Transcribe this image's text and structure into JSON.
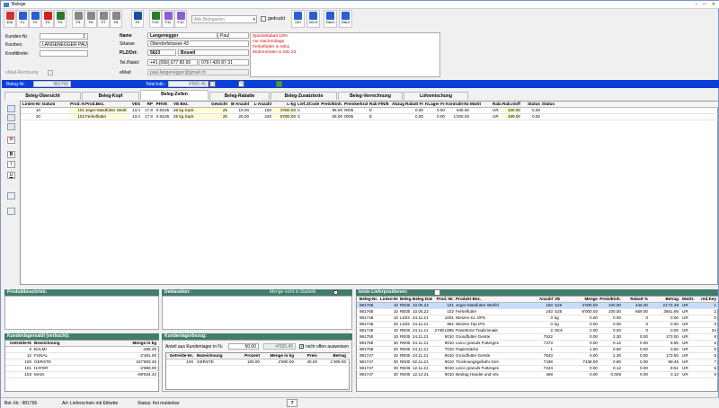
{
  "window": {
    "title": "Belege"
  },
  "toolbar": {
    "buttons": [
      "Exit",
      "F1",
      "F2",
      "F3",
      "F4",
      "F5",
      "F6",
      "F7",
      "F8",
      "F9",
      "F10",
      "F11",
      "F12"
    ],
    "group2": [
      "Ctrl",
      "Ctrl S",
      "ÖArV",
      "ÖArV"
    ],
    "filter_combo": "Alle Belegarten",
    "gedruckt_label": "gedruckt"
  },
  "customer": {
    "kunden_label": "Kunden-Nr.",
    "kunden_value": "1",
    "kurzbez_label": "Kurzbez.",
    "kurzbez_value": "LANGENEGGER PAU",
    "kredit_label": "Kreditlimite:",
    "name_label": "Name",
    "name_value": "Langenegger",
    "name_value2": "Paul",
    "strasse_label": "Strasse",
    "strasse_value": "Oberdorfstrasse 43",
    "plz_label": "PLZ/Ort:",
    "plz_value": "5623",
    "ort_value": "Boswil",
    "tel_label": "Tel./Natel:",
    "tel_value": "+41 (056) 677 80 65",
    "natel_value": "079 / 420 87 31",
    "email_label": "eMail:",
    "email_value": "paul.langenegger@gmail.ch",
    "email_rechnung_label": "eMail-Rechnung"
  },
  "notes": [
    "Spezialrabatt 10%",
    "nur Nachmittage",
    "Ferkelfutter in Silo1",
    "Mohrenfutter in Silo 23"
  ],
  "belegbar": {
    "nr_label": "Beleg-Nr.",
    "nr_value": "981766",
    "total_label": "Total inkl.:",
    "total_value": "4'655.45"
  },
  "tabs": [
    "Beleg-Übersicht",
    "Beleg-Kopf",
    "Beleg-Zeilen",
    "Beleg-Rabatte",
    "Beleg-Zusatztexte",
    "Beleg-Verrechnung",
    "Lohnmischung"
  ],
  "lines": {
    "headers": [
      "Linien-Nr.",
      "Datum",
      "Prod.-Nr.",
      "Prod.Bez.",
      "VES",
      "RP",
      "PH",
      "VE",
      "VE Bez.",
      "Gewicht",
      "B-Anzahl",
      "L-Anzahl",
      "L-kg",
      "Lief.Art",
      "ZCode",
      "Preis/Einh.",
      "Preiskerkraft",
      "Rab F/N/E",
      "Abzug",
      "Rabatt Fr.",
      "KLager Fr.",
      "Kontrakt-Nr.",
      "MwSt",
      "Rabatt offen",
      "Rab.n/offen",
      "Status"
    ],
    "rows": [
      [
        "10",
        "",
        "101",
        "Jeger-Mastfutter Würfel",
        "13.4",
        "17.8",
        "0.6",
        "S25",
        "25 kg Sack",
        "25",
        "10.00",
        "160",
        "4'000.00",
        "C",
        "",
        "95.00",
        "0005",
        "E",
        "",
        "0.00",
        "0.00",
        "945.00",
        "",
        "UR",
        "326.00",
        "0.00"
      ],
      [
        "20",
        "",
        "102",
        "Ferkelfutter",
        "13.4",
        "17.8",
        "0.6",
        "S25",
        "25 kg Sack",
        "25",
        "20.00",
        "240",
        "6'000.00",
        "C",
        "",
        "65.00",
        "0005",
        "E",
        "",
        "0.00",
        "0.00",
        "1'200.00",
        "",
        "UR",
        "489.00",
        "0.00"
      ]
    ]
  },
  "panels": {
    "produktbeschrieb": "Produktbeschrieb:",
    "deklaration": "Deklaration:",
    "menge_statistik": "Menge nicht in Statistik",
    "letzte": "letzte Lieferpositionen:"
  },
  "kundenlager": {
    "title": "Kundenlagersaldi (verbucht):",
    "headers": [
      "Getreide-Nr.",
      "Bezeichnung",
      "Menge in kg"
    ],
    "rows": [
      [
        "9",
        "BALMI",
        "-389.29"
      ],
      [
        "12",
        "FUNAL",
        "-2'481.00"
      ],
      [
        "100",
        "GERSTE",
        "157'803.26"
      ],
      [
        "101",
        "HAFER",
        "-2'890.00"
      ],
      [
        "103",
        "MAIS",
        "-89'534.44"
      ]
    ]
  },
  "kundenlagerbezug": {
    "title": "Kundenlagerbezug:",
    "anteil_label": "Anteil aus Kundenlager in %:",
    "anteil_value": "50.00",
    "betrag_value": "-4'655.45",
    "offen_label": "nicht offen ausweisen",
    "headers": [
      "Getreide-Nr.",
      "Bezeichnung",
      "Prozent",
      "Menge in kg",
      "Preis",
      "Betrag"
    ],
    "rows": [
      [
        "100",
        "GERSTE",
        "100.00",
        "2'800.00",
        "40.00",
        "1'308.00"
      ]
    ]
  },
  "letzte": {
    "headers": [
      "Beleg-Nr.",
      "Linien-Nr.",
      "Beleg",
      "Beleg Datum",
      "Prod.-Nr.",
      "Produkt Bez.",
      "Anzahl",
      "VE",
      "Menge",
      "Preis/Einh.",
      "Rabatt %",
      "Betrag",
      "MwSt.",
      "red.Key"
    ],
    "rows": [
      [
        "981766",
        "10",
        "RE05",
        "10.05.22",
        "101",
        "Jeger-Mastfutter Würfel",
        "160",
        "S25",
        "4'000.00",
        "100.00",
        "446.00",
        "21'72.48",
        "UR",
        "1"
      ],
      [
        "981765",
        "10",
        "RE05",
        "10.05.22",
        "102",
        "Ferkelfutter",
        "240",
        "S25",
        "6'000.00",
        "100.00",
        "669.00",
        "3561.95",
        "UR",
        "2"
      ],
      [
        "981748",
        "10",
        "LS03",
        "24.11.21",
        "1001",
        "Weizen KL 4/PS",
        "0",
        "kg",
        "0.00",
        "0.00",
        "0",
        "0.00",
        "UR",
        "0"
      ],
      [
        "981748",
        "20",
        "LS03",
        "24.11.21",
        "991",
        "Weizen Top IPS",
        "0",
        "kg",
        "0.00",
        "0.00",
        "0",
        "0.00",
        "UR",
        "0"
      ],
      [
        "981749",
        "10",
        "RE05",
        "24.11.21",
        "274E12B5",
        "Panettone Tradizionale Natali",
        "2",
        "Stck",
        "2.00",
        "0.00",
        "0",
        "0.00",
        "UR",
        "34"
      ],
      [
        "981750",
        "10",
        "RE05",
        "24.11.21",
        "9010",
        "Grundfutter Gerste",
        "7522",
        "",
        "0.00",
        "2.30",
        "0.00",
        "173.00",
        "UR",
        "6"
      ],
      [
        "981758",
        "30",
        "RE05",
        "24.11.21",
        "9010",
        "Leico granuls Futtergerade",
        "7373",
        "",
        "0.00",
        "0.12",
        "0.00",
        "8.85",
        "UR",
        "6"
      ],
      [
        "981758",
        "40",
        "RE05",
        "24.11.21",
        "7010",
        "Papiersäcke",
        "1",
        "",
        "1.00",
        "0.50",
        "0.00",
        "0.50",
        "UR",
        "6"
      ],
      [
        "981747",
        "10",
        "RE05",
        "24.11.21",
        "9010",
        "Grundfutter Gerste",
        "7543",
        "",
        "0.00",
        "2.30",
        "0.00",
        "173.50",
        "UR",
        "6"
      ],
      [
        "981747",
        "30",
        "RE05",
        "02.11.21",
        "9010",
        "Trocknungsgebühr Gerste",
        "7438",
        "",
        "7438.00",
        "0.80",
        "0.00",
        "59.45",
        "UR",
        "7"
      ],
      [
        "981747",
        "30",
        "RE05",
        "12.11.21",
        "9010",
        "Leico granuls Futtergerade",
        "7224",
        "",
        "0.00",
        "0.12",
        "0.00",
        "8.61",
        "UR",
        "6"
      ],
      [
        "981747",
        "30",
        "RE05",
        "12.12.21",
        "9010",
        "Beitrag Handel und Verarbeit.",
        "468",
        "",
        "0.00",
        "0.028",
        "0.00",
        "0.13",
        "UR",
        "6"
      ]
    ]
  },
  "status": {
    "beleg": "Bel.-Nr.: 981766",
    "art": "Art: Lieferschein mit Etikette",
    "st": "Status: frei mutierbar",
    "help": "?"
  },
  "colors": {
    "bar": "#0a3fd8",
    "section": "#3f7d6e",
    "note": "#e00000"
  }
}
